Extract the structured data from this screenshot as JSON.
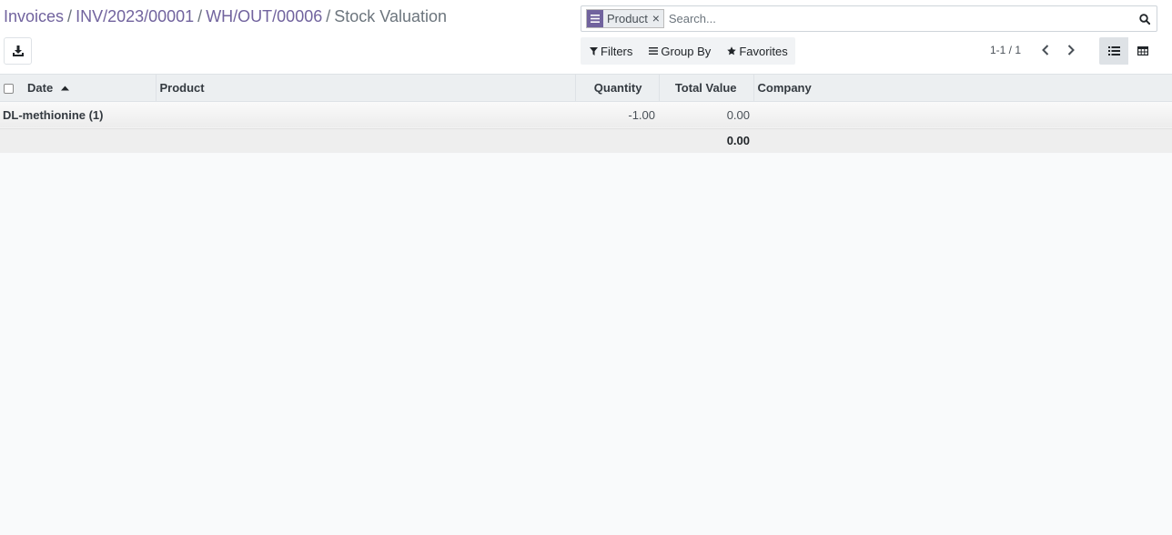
{
  "breadcrumbs": {
    "items": [
      "Invoices",
      "INV/2023/00001",
      "WH/OUT/00006"
    ],
    "separator": "/",
    "current": "Stock Valuation"
  },
  "search": {
    "facet_value": "Product",
    "facet_remove": "×",
    "placeholder": "Search..."
  },
  "filters": {
    "filters_label": "Filters",
    "group_by_label": "Group By",
    "favorites_label": "Favorites"
  },
  "pager": {
    "value": "1-1 / 1"
  },
  "table": {
    "columns": {
      "date": "Date",
      "product": "Product",
      "quantity": "Quantity",
      "total_value": "Total Value",
      "company": "Company"
    },
    "sorted_by": "date",
    "sort_direction": "ascending",
    "groups": [
      {
        "label": "DL-methionine (1)",
        "quantity": "-1.00",
        "total_value": "0.00"
      }
    ],
    "footer": {
      "total_value": "0.00"
    }
  },
  "colors": {
    "brand": "#71639e",
    "header_bg": "#eceff1",
    "page_bg": "#f9fafb"
  },
  "icons": [
    "download-icon",
    "facet-list-icon",
    "search-icon",
    "filter-icon",
    "group-by-icon",
    "star-icon",
    "chevron-left-icon",
    "chevron-right-icon",
    "list-view-icon",
    "pivot-view-icon",
    "sort-up-icon"
  ]
}
